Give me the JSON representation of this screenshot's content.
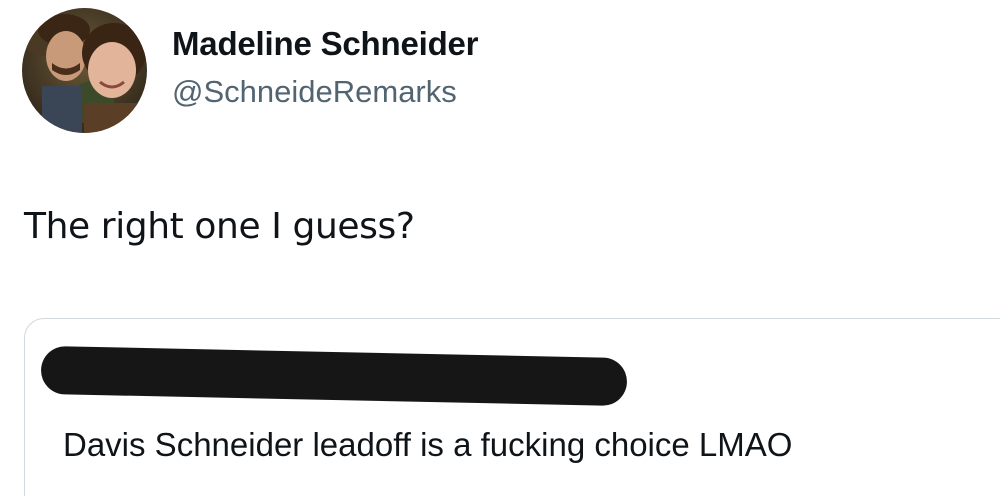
{
  "tweet": {
    "author": {
      "display_name": "Madeline Schneider",
      "handle": "@SchneideRemarks",
      "avatar_icon": "profile-photo"
    },
    "text": "The right one I guess?",
    "quoted_tweet": {
      "author_redacted": true,
      "text": "Davis Schneider leadoff is a fucking choice LMAO"
    }
  },
  "colors": {
    "text_primary": "#0f1419",
    "text_secondary": "#536471",
    "border": "#cfd9de",
    "redaction": "#161616",
    "background": "#ffffff"
  }
}
